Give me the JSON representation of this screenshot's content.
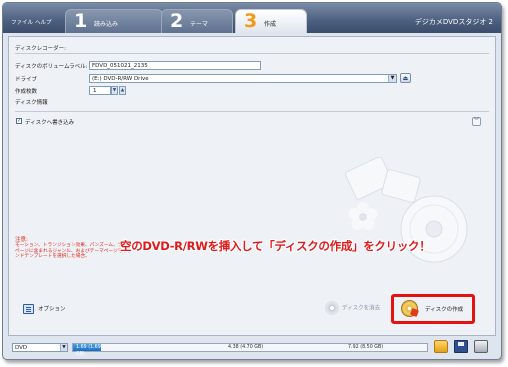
{
  "menu": {
    "file": "ファイル",
    "help": "ヘルプ"
  },
  "tabs": [
    {
      "num": "1",
      "label": "読み込み"
    },
    {
      "num": "2",
      "label": "テーマ"
    },
    {
      "num": "3",
      "label": "作成"
    }
  ],
  "app_title": "デジカメDVDスタジオ 2",
  "recorder": {
    "legend": "ディスクレコーダー:",
    "volume_label": "ディスクのボリュームラベル:",
    "volume_value": "FDVD_051021_2135",
    "drive_label": "ドライブ",
    "drive_value": "(E:) DVD-R/RW Drive",
    "copies_label": "作成枚数",
    "copies_value": "1",
    "disc_info_label": "ディスク情報",
    "write_checkbox_label": "ディスクへ書き込み"
  },
  "notice": {
    "title": "注意:",
    "text": "モーション、トランジション効果、パンズーム、テーマページに含まれるジャンル、およびテーマページでサウンドテンプレートを選択した場合、"
  },
  "callout": "空のDVD-R/RWを挿入して「ディスクの作成」をクリック！",
  "buttons": {
    "options": "オプション",
    "erase": "ディスクを消去",
    "create": "ディスクの作成"
  },
  "status": {
    "media": "DVD",
    "used": "1.69 (1.69 GB)",
    "marker1": "4.38 (4.70 GB)",
    "marker2": "7.92 (8.50 GB)",
    "used_fraction": 0.08
  },
  "colors": {
    "accent_tab": "#f09a1a",
    "callout": "#e0191b",
    "highlight": "#e5120f",
    "gauge": "#1a6cc3"
  }
}
